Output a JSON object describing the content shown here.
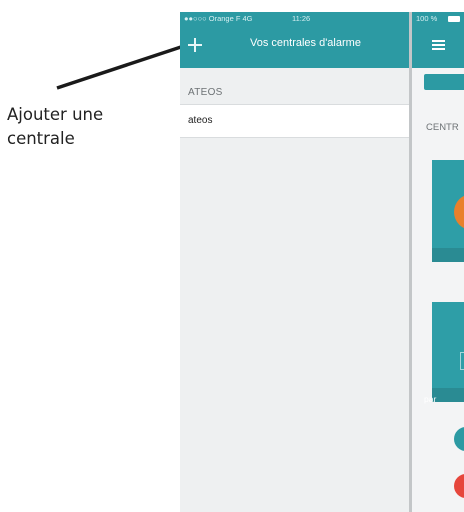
{
  "annotation": {
    "text": "Ajouter une centrale"
  },
  "left_screen": {
    "status": {
      "carrier": "●●○○○ Orange F  4G",
      "time": "11:26"
    },
    "nav": {
      "title": "Vos centrales d'alarme",
      "add_icon": "plus-icon"
    },
    "section_header": "ATEOS",
    "rows": [
      {
        "label": "ateos"
      }
    ]
  },
  "right_screen": {
    "status": {
      "battery": "100 %"
    },
    "nav": {
      "menu_icon": "hamburger-icon"
    },
    "section_header": "CENTR",
    "card_label": "par"
  },
  "colors": {
    "header_teal": "#2c9aa3",
    "orange": "#e9802b",
    "red": "#e6463c"
  }
}
